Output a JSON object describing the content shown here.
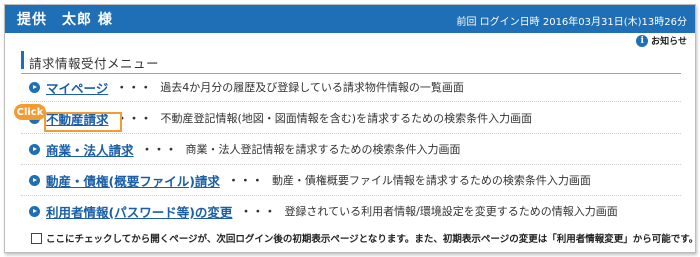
{
  "header": {
    "user_name": "提供　太郎 様",
    "last_login": "前回 ログイン日時 2016年03月31日(木)13時26分"
  },
  "notice": {
    "icon": "info-icon",
    "label": "お知らせ"
  },
  "section": {
    "title": "請求情報受付メニュー"
  },
  "menu": [
    {
      "label": "マイページ",
      "dots": "・・・",
      "description": "過去4か月分の履歴及び登録している請求物件情報の一覧画面"
    },
    {
      "label": "不動産請求",
      "dots": "・・・",
      "description": "不動産登記情報(地図・図面情報を含む)を請求するための検索条件入力画面"
    },
    {
      "label": "商業・法人請求",
      "dots": "・・・",
      "description": "商業・法人登記情報を請求するための検索条件入力画面"
    },
    {
      "label": "動産・債権(概要ファイル)請求",
      "dots": "・・・",
      "description": "動産・債権概要ファイル情報を請求するための検索条件入力画面"
    },
    {
      "label": "利用者情報(パスワード等)の変更",
      "dots": "・・・",
      "description": "登録されている利用者情報/環境設定を変更するための情報入力画面"
    }
  ],
  "annotation": {
    "click_label": "Click"
  },
  "checkbox": {
    "label": "ここにチェックしてから開くページが、次回ログイン後の初期表示ページとなります。また、初期表示ページの変更は「利用者情報変更」から可能です。"
  },
  "colors": {
    "header_bg": "#1f6fb6",
    "link": "#1a5ea8",
    "highlight": "#f39c33"
  }
}
